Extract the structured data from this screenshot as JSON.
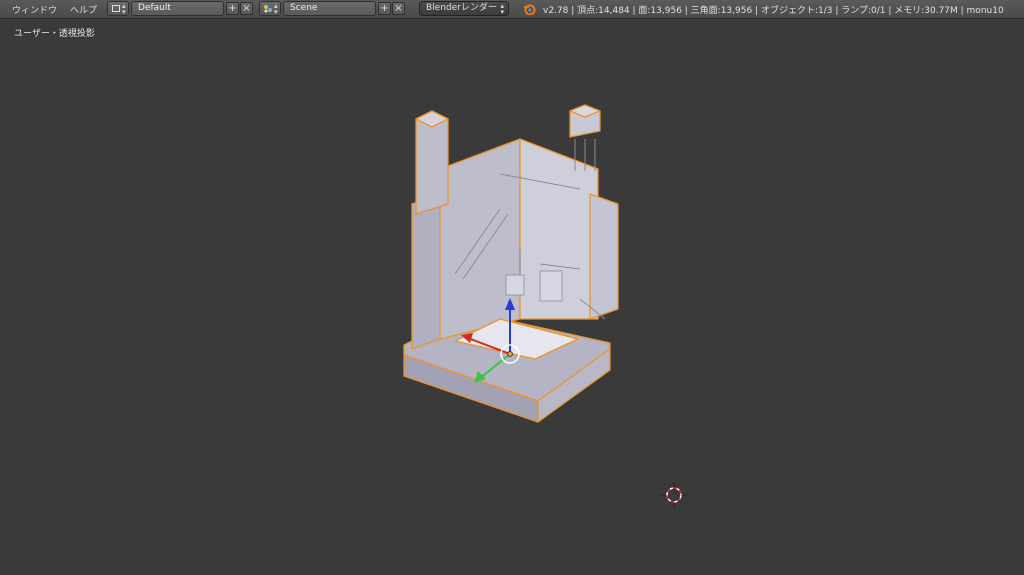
{
  "menu": {
    "window": "ウィンドウ",
    "help": "ヘルプ"
  },
  "screen_layout": {
    "value": "Default"
  },
  "scene": {
    "value": "Scene"
  },
  "render_engine": {
    "value": "Blenderレンダー"
  },
  "stats": {
    "text": "v2.78 | 頂点:14,484 | 面:13,956 | 三角面:13,956 | オブジェクト:1/3 | ランプ:0/1 | メモリ:30.77M | monu10"
  },
  "viewport": {
    "view_label": "ユーザー・透視投影"
  },
  "colors": {
    "background": "#3a3a3a",
    "model": "#c6c6d4",
    "selection_outline": "#e8952a",
    "axis_x": "#d42a2a",
    "axis_y": "#3ec43e",
    "axis_z": "#2a3ad4"
  },
  "icons": [
    "screen-layout-icon",
    "scene-icon",
    "add-icon",
    "close-icon",
    "blender-logo-icon",
    "cursor-3d-icon"
  ]
}
